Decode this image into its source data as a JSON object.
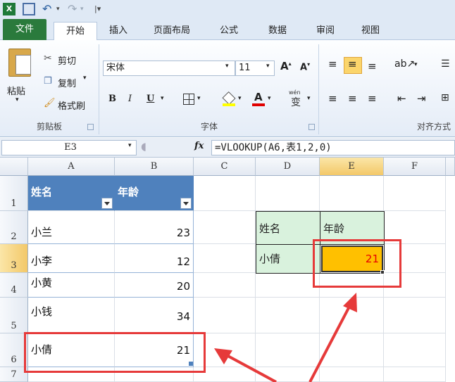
{
  "tabs": [
    "文件",
    "开始",
    "插入",
    "页面布局",
    "公式",
    "数据",
    "审阅",
    "视图"
  ],
  "clipboard": {
    "paste": "粘贴",
    "cut": "剪切",
    "copy": "复制",
    "format_painter": "格式刷",
    "group": "剪贴板"
  },
  "font": {
    "name": "宋体",
    "size": "11",
    "bold": "B",
    "italic": "I",
    "underline": "U",
    "color_letter": "A",
    "phonetic": "wén",
    "phonetic_char": "变",
    "group": "字体"
  },
  "alignment": {
    "group": "对齐方式"
  },
  "formula_bar": {
    "name_box": "E3",
    "fx": "fx",
    "formula": "=VLOOKUP(A6,表1,2,0)"
  },
  "columns": [
    "A",
    "B",
    "C",
    "D",
    "E",
    "F"
  ],
  "rows": [
    "1",
    "2",
    "3",
    "4",
    "5",
    "6",
    "7"
  ],
  "table": {
    "headers": [
      "姓名",
      "年龄"
    ],
    "rows": [
      {
        "name": "小兰",
        "age": "23"
      },
      {
        "name": "小李",
        "age": "12"
      },
      {
        "name": "小黄",
        "age": "20"
      },
      {
        "name": "小钱",
        "age": "34"
      },
      {
        "name": "小倩",
        "age": "21"
      }
    ]
  },
  "lookup": {
    "name_header": "姓名",
    "age_header": "年龄",
    "name_value": "小倩",
    "age_value": "21"
  },
  "colors": {
    "file_tab": "#2a7a3c",
    "table_header": "#4f81bd",
    "selected_cell": "#ffc000",
    "lookup_bg": "#d9f2dd",
    "annotation": "#e63a3a",
    "result_text": "#e60000"
  }
}
